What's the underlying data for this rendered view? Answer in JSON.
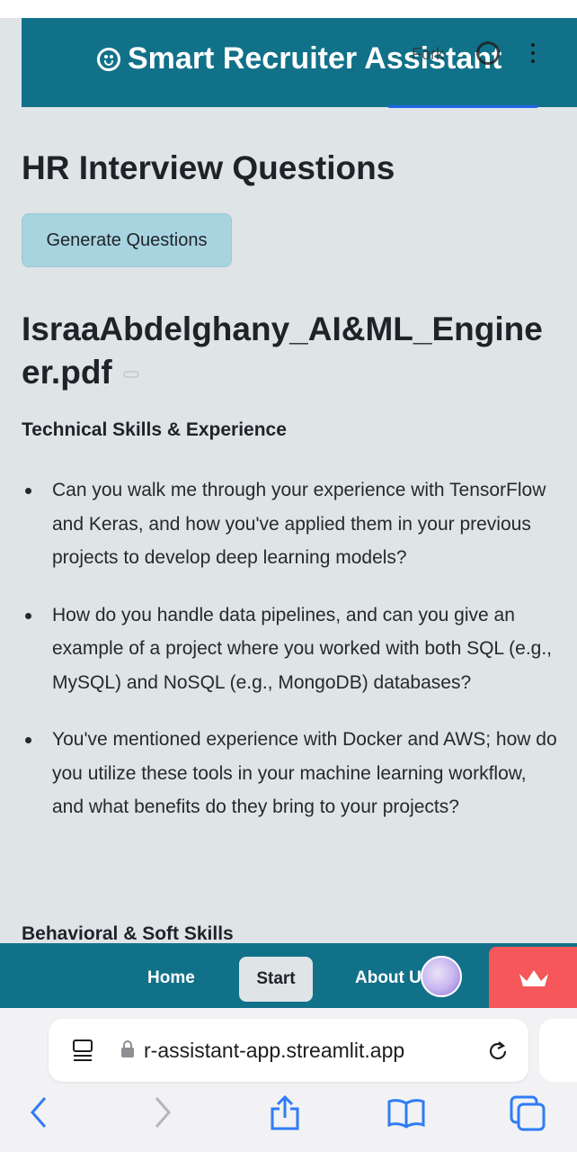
{
  "header": {
    "title": "Smart Recruiter Assistant",
    "fork_label": "Fork",
    "icons": [
      "smiley-icon",
      "github-icon",
      "kebab-menu-icon"
    ]
  },
  "main": {
    "page_title": "HR Interview Questions",
    "generate_button_label": "Generate Questions",
    "file_title": "IsraaAbdelghany_AI&ML_Engineer.pdf",
    "section_technical": "Technical Skills & Experience",
    "questions": [
      "Can you walk me through your experience with TensorFlow and Keras, and how you've applied them in your previous projects to develop deep learning models?",
      "How do you handle data pipelines, and can you give an example of a project where you worked with both SQL (e.g., MySQL) and NoSQL (e.g., MongoDB) databases?",
      "You've mentioned experience with Docker and AWS; how do you utilize these tools in your machine learning workflow, and what benefits do they bring to your projects?"
    ],
    "section_behavioral": "Behavioral & Soft Skills"
  },
  "bottom_nav": {
    "home_label": "Home",
    "start_label": "Start",
    "about_label": "About Us"
  },
  "browser": {
    "url": "r-assistant-app.streamlit.app"
  },
  "colors": {
    "header_bg": "#117189",
    "page_bg": "#dfe4e7",
    "button_bg": "#a8d4e0",
    "streamlit_badge": "#f5575a",
    "ios_blue": "#2f7cf6"
  }
}
